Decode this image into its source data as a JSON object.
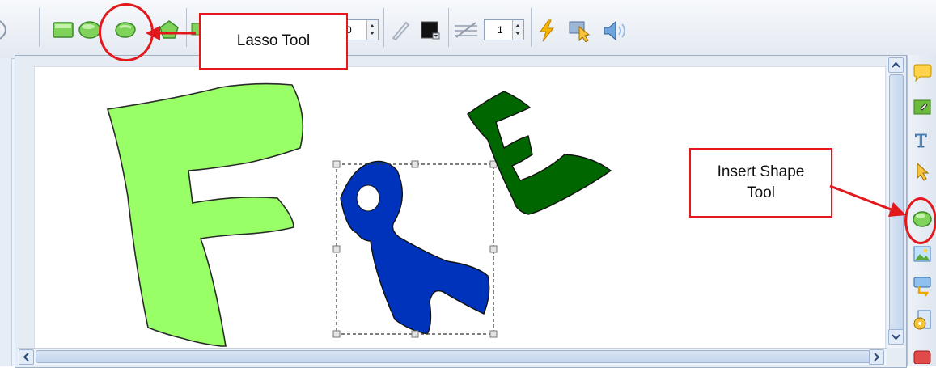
{
  "toolbar": {
    "spinner_width_value": "0",
    "spinner_lines_value": "1",
    "icons": [
      "rectangle-shape-icon",
      "ellipse-shape-icon",
      "lasso-tool-icon",
      "polygon-shape-icon",
      "pen-icon",
      "color-swatch-icon",
      "line-style-icon",
      "lightning-icon",
      "pointer-icon",
      "speaker-icon"
    ]
  },
  "canvas": {
    "letters": [
      "F",
      "R",
      "E"
    ]
  },
  "sidebar": {
    "icons": [
      "comment-icon",
      "ink-icon",
      "text-icon",
      "select-pointer-icon",
      "insert-shape-icon",
      "insert-image-icon",
      "insert-button-icon",
      "insert-media-icon",
      "close-icon"
    ]
  },
  "callouts": {
    "lasso": "Lasso Tool",
    "insert_shape_line1": "Insert Shape",
    "insert_shape_line2": "Tool"
  },
  "colors": {
    "callout_red": "#e2181d",
    "letter_f": "#99ff66",
    "letter_r": "#0033bb",
    "letter_e": "#006600",
    "scroll_thumb": "#c4d6ee"
  }
}
